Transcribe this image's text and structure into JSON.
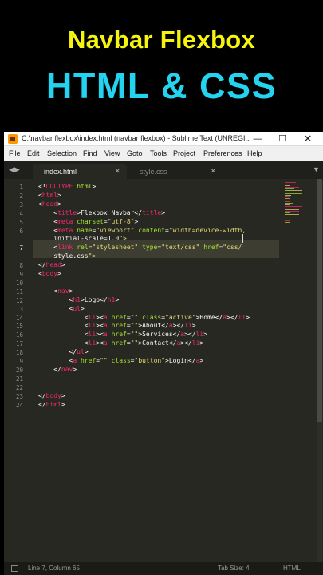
{
  "banner": {
    "title": "Navbar Flexbox",
    "subtitle": "HTML & CSS"
  },
  "window": {
    "title": "C:\\navbar flexbox\\index.html (navbar flexbox) - Sublime Text (UNREGI...",
    "min": "—",
    "max": "☐",
    "close": "✕"
  },
  "menu": [
    "File",
    "Edit",
    "Selection",
    "Find",
    "View",
    "Goto",
    "Tools",
    "Project",
    "Preferences",
    "Help"
  ],
  "tabs": [
    {
      "label": "index.html",
      "close": "✕"
    },
    {
      "label": "style.css",
      "close": "✕"
    }
  ],
  "tab_arrows": {
    "left": "◀▶",
    "right": "▼"
  },
  "line_numbers": [
    "1",
    "2",
    "3",
    "4",
    "5",
    "6",
    "",
    "7",
    "",
    "8",
    "9",
    "10",
    "11",
    "12",
    "13",
    "14",
    "15",
    "16",
    "17",
    "18",
    "19",
    "20",
    "21",
    "22",
    "23",
    "24"
  ],
  "code": [
    "<!DOCTYPE html>",
    "<html>",
    "<head>",
    "    <title>Flexbox Navbar</title>",
    "    <meta charset=\"utf-8\">",
    "    <meta name=\"viewport\" content=\"width=device-width,",
    "    initial-scale=1.0\">",
    "    <link rel=\"stylesheet\" type=\"text/css\" href=\"css/",
    "    style.css\">",
    "</head>",
    "<body>",
    "",
    "    <nav>",
    "        <h1>Logo</h1>",
    "        <ul>",
    "            <li><a href=\"\" class=\"active\">Home</a></li>",
    "            <li><a href=\"\">About</a></li>",
    "            <li><a href=\"\">Services</a></li>",
    "            <li><a href=\"\">Contact</a></li>",
    "        </ul>",
    "        <a href=\"\" class=\"button\">Login</a>",
    "    </nav>",
    "",
    "",
    "</body>",
    "</html>"
  ],
  "status": {
    "position": "Line 7, Column 65",
    "tab_size": "Tab Size: 4",
    "syntax": "HTML"
  },
  "colors": {
    "banner_title": "#f4f40e",
    "banner_subtitle": "#23d3f0",
    "editor_bg": "#272822",
    "tag": "#f92672",
    "attr": "#a6e22e",
    "string": "#e6db74"
  }
}
